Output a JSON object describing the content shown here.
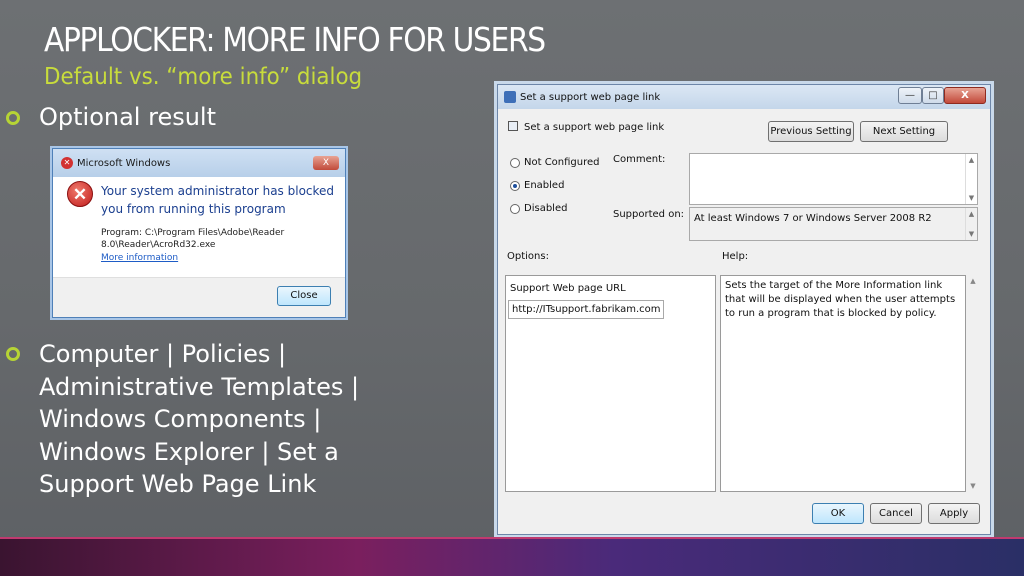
{
  "slide": {
    "title": "APPLOCKER: MORE INFO FOR USERS",
    "subtitle": "Default vs. “more info” dialog",
    "bullets": [
      "Optional result",
      "Computer | Policies | Administrative Templates | Windows Components | Windows Explorer | Set a Support Web Page Link"
    ],
    "accent_color": "#c8dc3c"
  },
  "blocked_dialog": {
    "title": "Microsoft Windows",
    "close_glyph": "X",
    "heading": "Your system administrator has blocked you from running this program",
    "program_line": "Program: C:\\Program Files\\Adobe\\Reader 8.0\\Reader\\AcroRd32.exe",
    "link": "More information",
    "close_button": "Close",
    "icon": "error-icon"
  },
  "policy_dialog": {
    "window_title": "Set a support web page link",
    "header_title": "Set a support web page link",
    "previous_button": "Previous Setting",
    "next_button": "Next Setting",
    "options": {
      "not_configured": "Not Configured",
      "enabled": "Enabled",
      "disabled": "Disabled",
      "selected": "enabled"
    },
    "comment_label": "Comment:",
    "comment_value": "",
    "supported_label": "Supported on:",
    "supported_value": "At least Windows 7 or Windows Server 2008 R2",
    "options_label": "Options:",
    "help_label": "Help:",
    "url_label": "Support Web page URL",
    "url_value": "http://ITsupport.fabrikam.com",
    "help_text": "Sets the target of the More Information link that will be displayed when the user attempts to run a program that is blocked by policy.",
    "ok_button": "OK",
    "cancel_button": "Cancel",
    "apply_button": "Apply",
    "window_controls": {
      "minimize": "—",
      "maximize": "□",
      "close": "X"
    }
  }
}
